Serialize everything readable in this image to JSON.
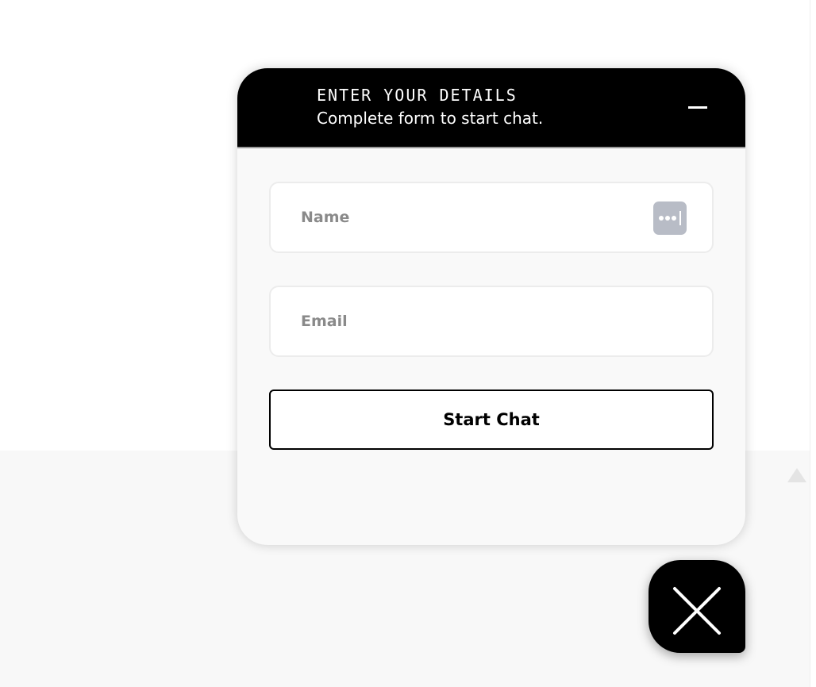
{
  "chat_widget": {
    "header": {
      "title": "ENTER YOUR DETAILS",
      "subtitle": "Complete form to start chat.",
      "minimize_icon": "minimize-icon"
    },
    "form": {
      "name_placeholder": "Name",
      "name_value": "",
      "email_placeholder": "Email",
      "email_value": "",
      "autofill_icon": "password-manager-icon",
      "submit_label": "Start Chat"
    },
    "launcher": {
      "icon": "close-icon"
    }
  },
  "colors": {
    "header_bg": "#000000",
    "panel_bg": "#f9f9f9",
    "button_border": "#000000",
    "autofill_icon_bg": "#b8bcc6"
  }
}
